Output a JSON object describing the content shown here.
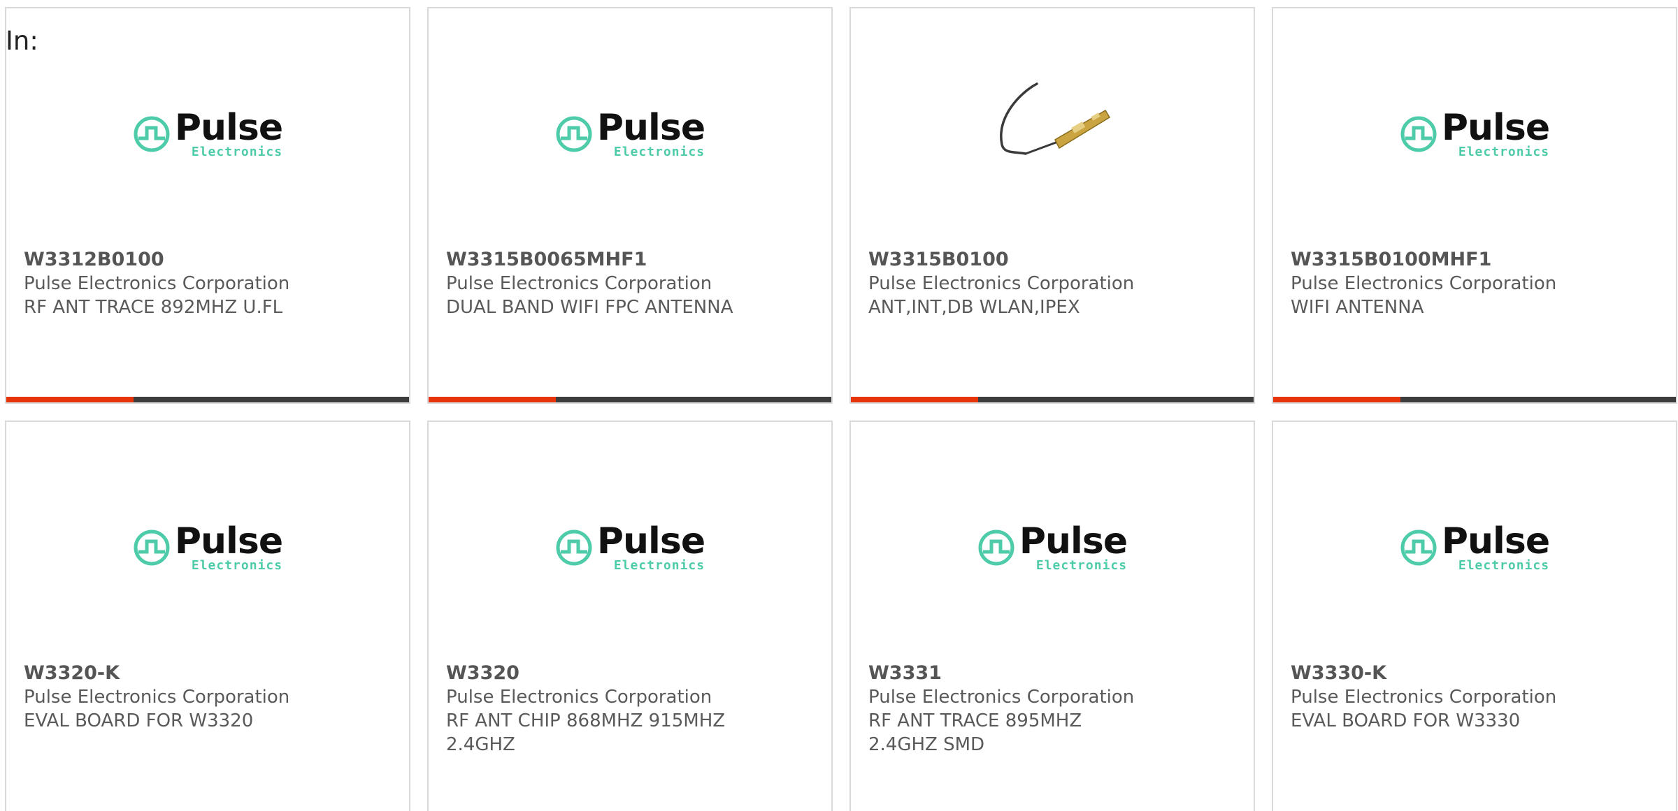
{
  "filter": {
    "label": "In:"
  },
  "colors": {
    "accent": "#e8340b",
    "bar": "#3d3d3d",
    "logo_teal": "#4ecba9"
  },
  "logo": {
    "word": "Pulse",
    "sub": "Electronics"
  },
  "products": [
    {
      "part": "W3312B0100",
      "manufacturer": "Pulse Electronics Corporation",
      "description": "RF ANT TRACE 892MHZ U.FL",
      "image": "pulse-logo"
    },
    {
      "part": "W3315B0065MHF1",
      "manufacturer": "Pulse Electronics Corporation",
      "description": "DUAL BAND WIFI FPC ANTENNA",
      "image": "pulse-logo"
    },
    {
      "part": "W3315B0100",
      "manufacturer": "Pulse Electronics Corporation",
      "description": "ANT,INT,DB WLAN,IPEX",
      "image": "antenna-photo"
    },
    {
      "part": "W3315B0100MHF1",
      "manufacturer": "Pulse Electronics Corporation",
      "description": "WIFI ANTENNA",
      "image": "pulse-logo"
    },
    {
      "part": "W3320-K",
      "manufacturer": "Pulse Electronics Corporation",
      "description": "EVAL BOARD FOR W3320",
      "image": "pulse-logo"
    },
    {
      "part": "W3320",
      "manufacturer": "Pulse Electronics Corporation",
      "description": "RF ANT CHIP 868MHZ 915MHZ 2.4GHZ",
      "image": "pulse-logo"
    },
    {
      "part": "W3331",
      "manufacturer": "Pulse Electronics Corporation",
      "description": "RF ANT TRACE 895MHZ 2.4GHZ SMD",
      "image": "pulse-logo"
    },
    {
      "part": "W3330-K",
      "manufacturer": "Pulse Electronics Corporation",
      "description": "EVAL BOARD FOR W3330",
      "image": "pulse-logo"
    }
  ]
}
